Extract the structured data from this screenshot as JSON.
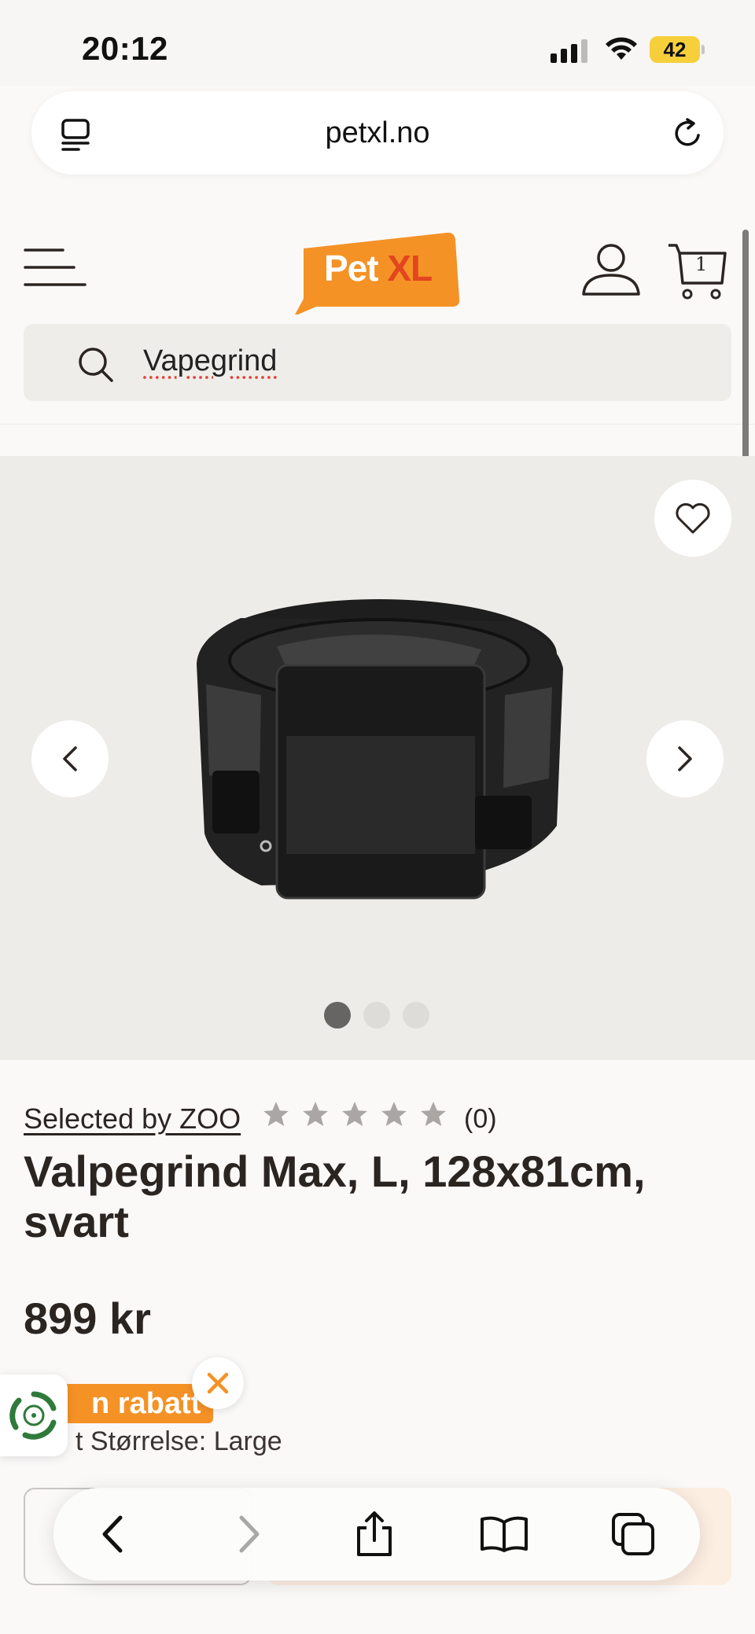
{
  "status_bar": {
    "time": "20:12",
    "battery": "42"
  },
  "browser": {
    "url": "petxl.no"
  },
  "header": {
    "logo_part1": "Pet",
    "logo_part2": "XL",
    "cart_count": "1",
    "search_value": "Vapegrind"
  },
  "gallery": {
    "image_count": 3,
    "active_index": 0
  },
  "product": {
    "brand": "Selected by ZOO",
    "rating": 0,
    "review_count": "(0)",
    "title": "Valpegrind Max, L, 128x81cm, svart",
    "price": "899 kr",
    "discount_badge": "n rabatt",
    "size_label": "t Størrelse: Large"
  },
  "colors": {
    "brand_orange": "#f49226",
    "logo_accent": "#e2451f",
    "text_primary": "#2b2522",
    "gallery_bg": "#eeece8"
  },
  "icons": {
    "tabs_overview": "tabs-overview-icon",
    "reload": "reload-icon",
    "menu": "hamburger-menu-icon",
    "user": "user-icon",
    "cart": "cart-icon",
    "search": "search-icon",
    "favorite": "heart-icon",
    "prev": "chevron-left-icon",
    "next": "chevron-right-icon",
    "star": "star-icon",
    "recycle": "recycle-icon",
    "close": "close-icon",
    "share": "share-icon",
    "bookmarks": "book-icon",
    "tabs": "tabs-icon"
  }
}
